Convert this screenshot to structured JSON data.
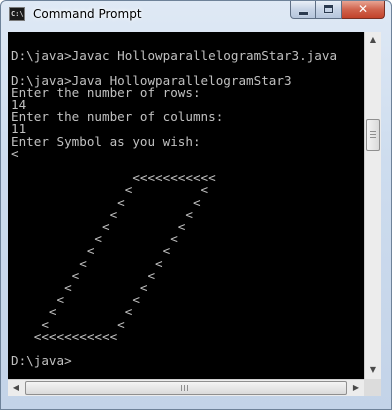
{
  "window": {
    "title": "Command Prompt",
    "icon": "cmd-window-icon",
    "icon_text": "C:\\",
    "buttons": {
      "minimize": "minimize-icon",
      "maximize": "maximize-icon",
      "close": "close-icon",
      "close_glyph": "✕"
    }
  },
  "console": {
    "foreground_color": "#c0c0c0",
    "background_color": "#000000",
    "lines": [
      "",
      "D:\\java>Javac HollowparallelogramStar3.java",
      "",
      "D:\\java>Java HollowparallelogramStar3",
      "Enter the number of rows:",
      "14",
      "Enter the number of columns:",
      "11",
      "Enter Symbol as you wish:",
      "<",
      "",
      "                <<<<<<<<<<<",
      "               <         <",
      "              <         <",
      "             <         <",
      "            <         <",
      "           <         <",
      "          <         <",
      "         <         <",
      "        <         <",
      "       <         <",
      "      <         <",
      "     <         <",
      "    <         <",
      "   <<<<<<<<<<<",
      "",
      "D:\\java>"
    ]
  },
  "scrollbars": {
    "up_arrow": "▲",
    "down_arrow": "▼",
    "left_arrow": "◀",
    "right_arrow": "▶"
  }
}
